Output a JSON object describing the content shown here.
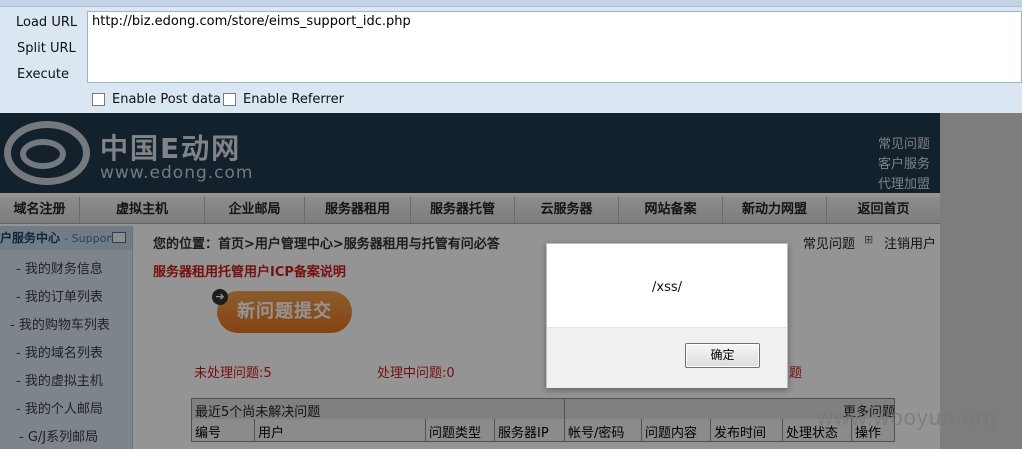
{
  "hackbar": {
    "buttons": [
      "Load URL",
      "Split URL",
      "Execute"
    ],
    "url": "http://biz.edong.com/store/eims_support_idc.php",
    "checkboxes": [
      "Enable Post data",
      "Enable Referrer"
    ]
  },
  "site": {
    "logo_cn": "中国E动网",
    "logo_en": "www.edong.com",
    "top_links": [
      "常见问题",
      "客户服务",
      "代理加盟"
    ],
    "nav": [
      "域名注册",
      "虚拟主机",
      "企业邮局",
      "服务器租用",
      "服务器托管",
      "云服务器",
      "网站备案",
      "新动力网盟",
      "返回首页"
    ]
  },
  "sidebar": {
    "title": "户服务中心",
    "subtitle": "- Support",
    "items": [
      "- 我的财务信息",
      "- 我的订单列表",
      "- 我的购物车列表",
      "- 我的域名列表",
      "- 我的虚拟主机",
      "- 我的个人邮局",
      "- G/J系列邮局"
    ]
  },
  "content": {
    "breadcrumb": "您的位置：首页>用户管理中心>服务器租用与托管有问必答",
    "right_links": [
      "常见问题",
      "注销用户"
    ],
    "notice": "服务器租用托管用户ICP备案说明",
    "new_question": "新问题提交",
    "stats": [
      "未处理问题:5",
      "处理中问题:0",
      "题"
    ],
    "table_title": "最近5个尚未解决问题",
    "more": "更多问题",
    "columns": [
      "编号",
      "用户",
      "问题类型",
      "服务器IP",
      "帐号/密码",
      "问题内容",
      "发布时间",
      "处理状态",
      "操作"
    ]
  },
  "dialog": {
    "message": "/xss/",
    "ok_label": "确定"
  },
  "watermark": "www.wooyun.org",
  "colors": {
    "banner_bg": "#21394f",
    "notice_red": "#cc1c1c",
    "button_orange": "#e5721f",
    "hackbar_bg": "#dbe6f3"
  }
}
